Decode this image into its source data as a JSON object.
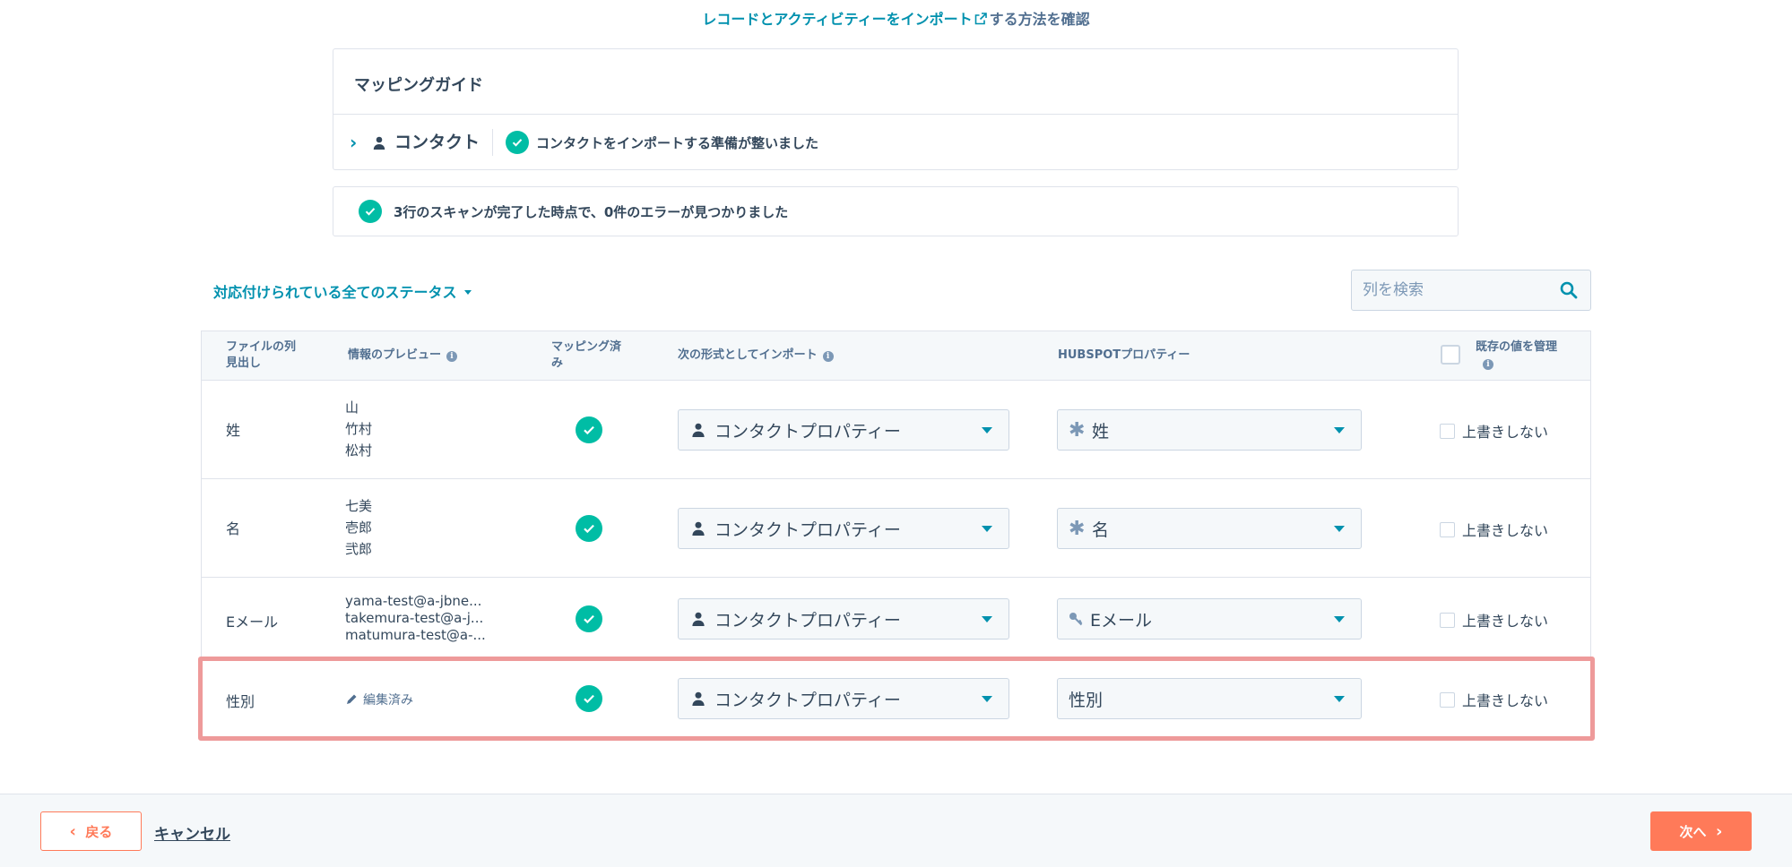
{
  "help": {
    "link": "レコードとアクティビティーをインポート",
    "rest": "する方法を確認"
  },
  "guide": {
    "title": "マッピングガイド",
    "object": "コンタクト",
    "status": "コンタクトをインポートする準備が整いました"
  },
  "scan": {
    "message": "3行のスキャンが完了した時点で、0件のエラーが見つかりました"
  },
  "filter": {
    "label": "対応付けられている全てのステータス"
  },
  "search": {
    "placeholder": "列を検索"
  },
  "table": {
    "headers": {
      "file_col": "ファイルの列\n見出し",
      "preview": "情報のプレビュー",
      "mapped": "マッピング済\nみ",
      "import_as": "次の形式としてインポート",
      "hubspot": "HUBSPOTプロパティー",
      "manage": "既存の値を管理"
    },
    "rows": [
      {
        "col": "姓",
        "preview": [
          "山",
          "竹村",
          "松村"
        ],
        "type": "コンタクトプロパティー",
        "property": "姓",
        "prop_icon": "asterisk-icon",
        "overwrite": "上書きしない"
      },
      {
        "col": "名",
        "preview": [
          "七美",
          "壱郎",
          "弐郎"
        ],
        "type": "コンタクトプロパティー",
        "property": "名",
        "prop_icon": "asterisk-icon",
        "overwrite": "上書きしない"
      },
      {
        "col": "Eメール",
        "preview": [
          "yama-test@a-jbne...",
          "takemura-test@a-j...",
          "matumura-test@a-..."
        ],
        "type": "コンタクトプロパティー",
        "property": "Eメール",
        "prop_icon": "key-icon",
        "overwrite": "上書きしない"
      },
      {
        "col": "性別",
        "edited": "編集済み",
        "type": "コンタクトプロパティー",
        "property": "性別",
        "overwrite": "上書きしない"
      }
    ]
  },
  "footer": {
    "back": "戻る",
    "cancel": "キャンセル",
    "next": "次へ"
  },
  "colors": {
    "accent": "#0091ae",
    "success": "#00bda5",
    "primary": "#ff7a59",
    "highlight": "#ee9a9a"
  }
}
